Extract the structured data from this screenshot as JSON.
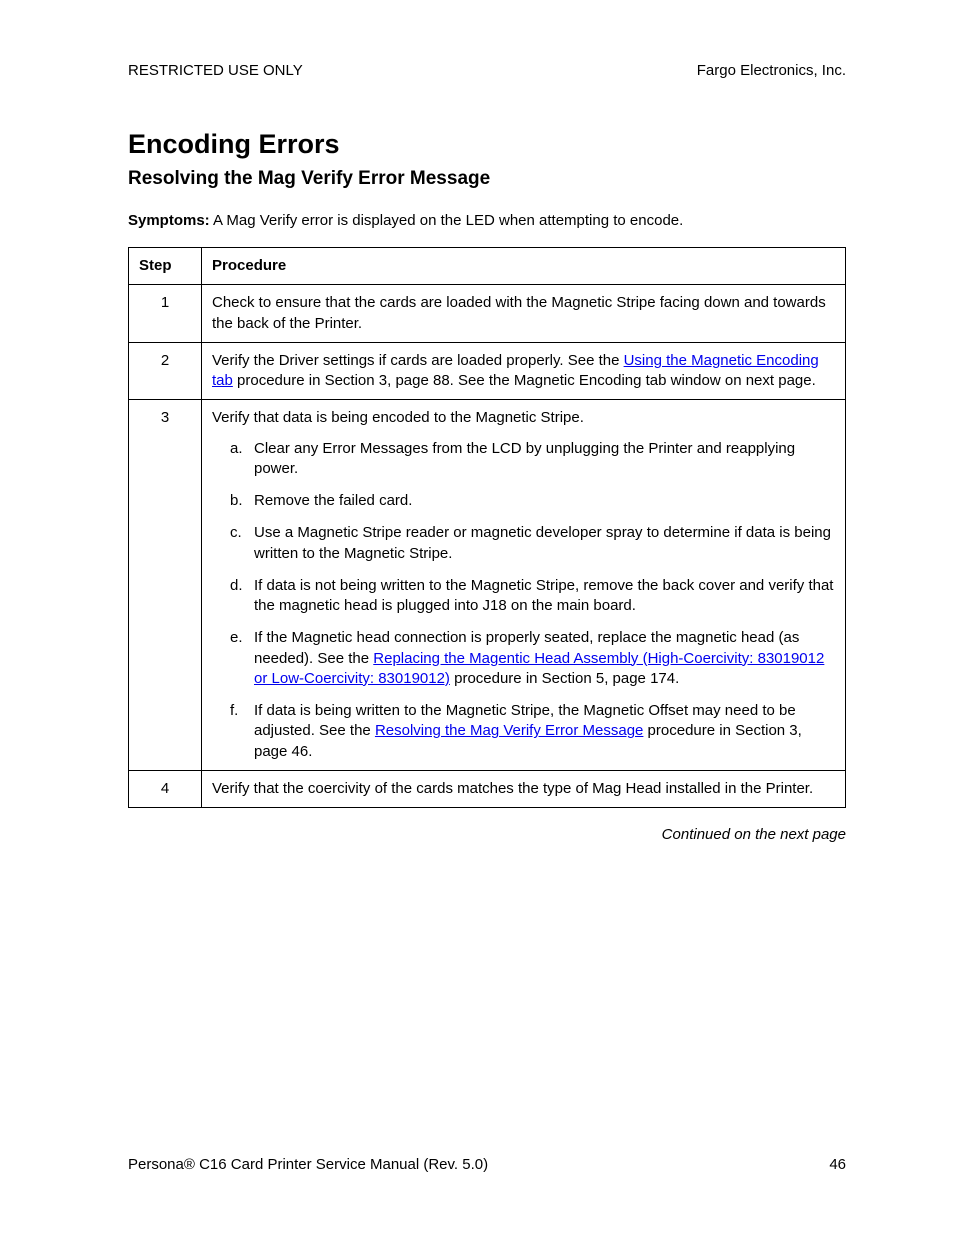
{
  "header": {
    "left": "RESTRICTED USE ONLY",
    "right": "Fargo Electronics, Inc."
  },
  "title": "Encoding Errors",
  "subtitle": "Resolving the Mag Verify Error Message",
  "symptoms": {
    "label": "Symptoms:",
    "text": "  A Mag Verify error is displayed on the LED when attempting to encode."
  },
  "table": {
    "head": {
      "step": "Step",
      "proc": "Procedure"
    },
    "rows": {
      "r1": {
        "step": "1",
        "text": "Check to ensure that the cards are loaded with the Magnetic Stripe facing down and towards the back of the Printer."
      },
      "r2": {
        "step": "2",
        "pre": "Verify the Driver settings if cards are loaded properly. See the ",
        "link": "Using the Magnetic Encoding tab",
        "post": " procedure in Section 3, page 88. See the Magnetic Encoding tab window on next page."
      },
      "r3": {
        "step": "3",
        "intro": "Verify that data is being encoded to the Magnetic Stripe.",
        "a": {
          "letter": "a.",
          "text": "Clear any Error Messages from the LCD by unplugging the Printer and reapplying power."
        },
        "b": {
          "letter": "b.",
          "text": "Remove the failed card."
        },
        "c": {
          "letter": "c.",
          "text": "Use a Magnetic Stripe reader or magnetic developer spray to determine if data is being written to the Magnetic Stripe."
        },
        "d": {
          "letter": "d.",
          "text": "If data is not being written to the Magnetic Stripe, remove the back cover and verify that the magnetic head is plugged into J18 on the main board."
        },
        "e": {
          "letter": "e.",
          "pre": "If the Magnetic head connection is properly seated, replace the magnetic head (as needed). See the ",
          "link": "Replacing the Magentic Head Assembly (High-Coercivity: 83019012 or Low-Coercivity: 83019012)",
          "post": " procedure in Section 5, page 174."
        },
        "f": {
          "letter": "f.",
          "pre": "If data is being written to the Magnetic Stripe, the Magnetic Offset may need to be adjusted. See the ",
          "link": "Resolving the Mag Verify Error Message",
          "post": " procedure in Section 3, page 46."
        }
      },
      "r4": {
        "step": "4",
        "text": "Verify that the coercivity of the cards matches the type of Mag Head installed in the Printer."
      }
    }
  },
  "continued": "Continued on the next page",
  "footer": {
    "left": "Persona® C16 Card Printer Service Manual (Rev. 5.0)",
    "right": "46"
  }
}
